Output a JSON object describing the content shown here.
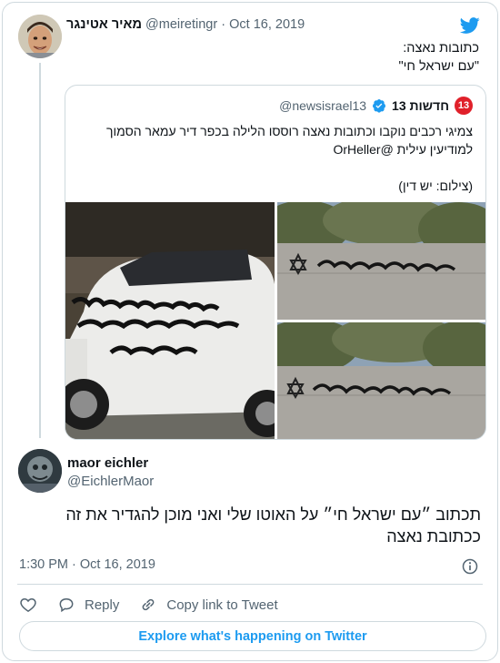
{
  "parent": {
    "name": "מאיר אטינגר",
    "handle": "@meiretingr",
    "date": "Oct 16, 2019",
    "separator": "·",
    "text_lines": [
      "כתובות נאצה:",
      "\"עם ישראל חי\""
    ]
  },
  "quote": {
    "badge": "13",
    "name": "חדשות 13",
    "handle": "@newsisrael13",
    "text_line1": "צמיגי רכבים נוקבו וכתובות נאצה רוססו הלילה בכפר דיר עמאר הסמוך",
    "text_line2": "למודיעין עילית @OrHeller",
    "text_line3": "(צילום: יש דין)"
  },
  "reply": {
    "name": "maor eichler",
    "handle": "@EichlerMaor",
    "text": "תכתוב ״עם ישראל חי״ על האוטו שלי ואני מוכן להגדיר את זה ככתובת נאצה",
    "timestamp": "1:30 PM · Oct 16, 2019"
  },
  "actions": {
    "reply_label": "Reply",
    "copy_label": "Copy link to Tweet"
  },
  "explore_label": "Explore what's happening on Twitter",
  "colors": {
    "accent": "#1d9bf0",
    "badge_red": "#e0202a",
    "secondary_text": "#536471",
    "border": "#cfd9de"
  },
  "icons": [
    "twitter-bird-icon",
    "verified-icon",
    "info-icon",
    "heart-icon",
    "reply-icon",
    "link-icon"
  ]
}
